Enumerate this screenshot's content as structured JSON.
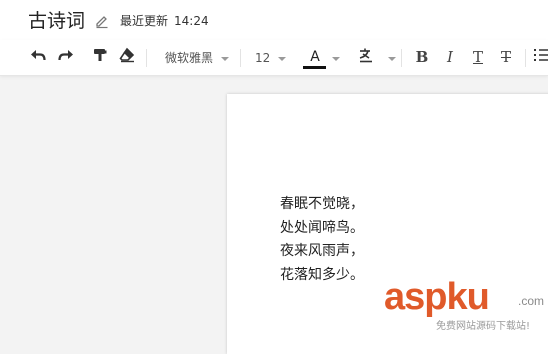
{
  "document": {
    "title": "古诗词",
    "status_label": "最近更新",
    "status_time": "14:24"
  },
  "toolbar": {
    "font_family": "微软雅黑",
    "font_size": "12",
    "font_color_letter": "A",
    "font_color": "#111111",
    "bold_label": "B",
    "italic_label": "I",
    "underline_label": "T",
    "strikethrough_label": "T",
    "icons": [
      "undo-icon",
      "redo-icon",
      "format-painter-icon",
      "clear-format-icon",
      "highlight-icon",
      "ordered-list-icon"
    ]
  },
  "poem": {
    "lines": [
      "春眠不觉晓，",
      "处处闻啼鸟。",
      "夜来风雨声，",
      "花落知多少。"
    ]
  },
  "watermark": {
    "brand": "aspku",
    "suffix": ".com",
    "tagline": "免费网站源码下载站!",
    "color": "#e05a2a"
  }
}
